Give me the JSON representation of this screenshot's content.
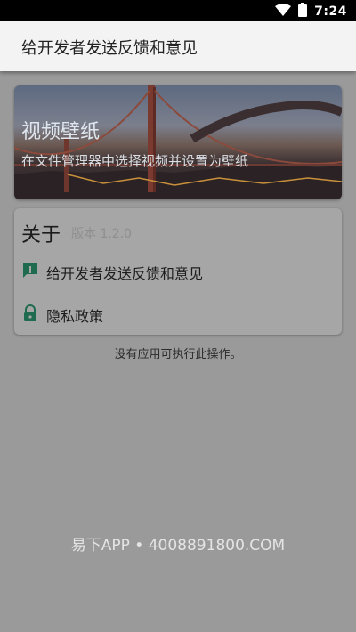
{
  "status_bar": {
    "time": "7:24"
  },
  "app_bar": {
    "title": "给开发者发送反馈和意见"
  },
  "banner": {
    "title": "视频壁纸",
    "subtitle": "在文件管理器中选择视频并设置为壁纸"
  },
  "about": {
    "title": "关于",
    "version": "版本 1.2.0",
    "items": [
      {
        "label": "给开发者发送反馈和意见",
        "icon": "feedback-icon"
      },
      {
        "label": "隐私政策",
        "icon": "lock-icon"
      }
    ]
  },
  "toast": "没有应用可执行此操作。",
  "watermark": "易下APP • 4008891800.COM",
  "colors": {
    "accent": "#1f6b4f"
  }
}
